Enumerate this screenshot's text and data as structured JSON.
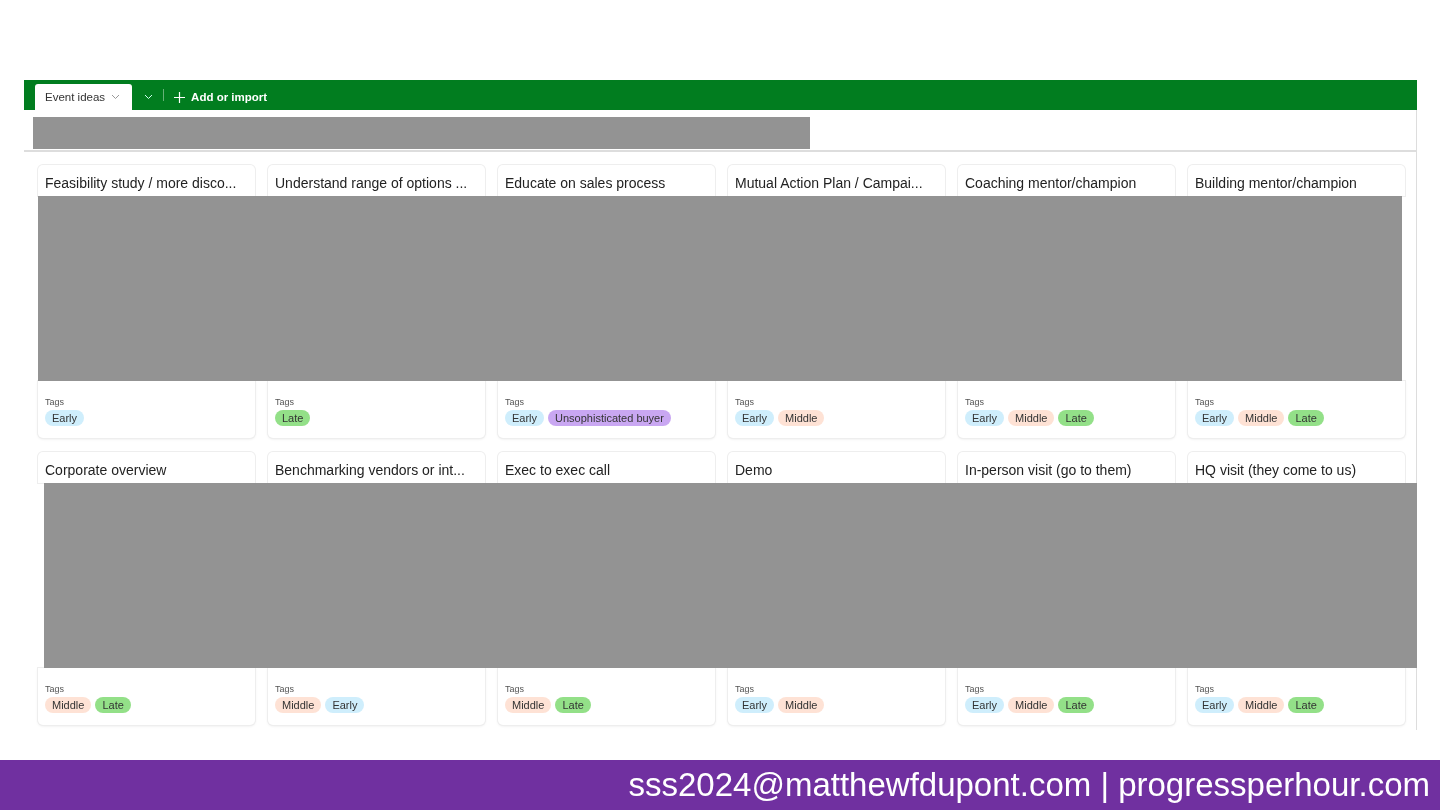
{
  "tab_bar": {
    "tabs": [
      {
        "label": "Event ideas",
        "selected": true
      }
    ],
    "add_button": "Add or import"
  },
  "cards": [
    {
      "title": "Feasibility study / more disco...",
      "tags_label": "Tags",
      "tags": [
        {
          "label": "Early",
          "color": "#cfeefc"
        }
      ]
    },
    {
      "title": "Understand range of options ...",
      "tags_label": "Tags",
      "tags": [
        {
          "label": "Late",
          "color": "#93e088"
        }
      ]
    },
    {
      "title": "Educate on sales process",
      "tags_label": "Tags",
      "tags": [
        {
          "label": "Early",
          "color": "#cfeefc"
        },
        {
          "label": "Unsophisticated buyer",
          "color": "#c9a7f2"
        }
      ]
    },
    {
      "title": "Mutual Action Plan / Campai...",
      "tags_label": "Tags",
      "tags": [
        {
          "label": "Early",
          "color": "#cfeefc"
        },
        {
          "label": "Middle",
          "color": "#fee2d5"
        }
      ]
    },
    {
      "title": "Coaching mentor/champion",
      "tags_label": "Tags",
      "tags": [
        {
          "label": "Early",
          "color": "#cfeefc"
        },
        {
          "label": "Middle",
          "color": "#fee2d5"
        },
        {
          "label": "Late",
          "color": "#93e088"
        }
      ]
    },
    {
      "title": "Building mentor/champion",
      "tags_label": "Tags",
      "tags": [
        {
          "label": "Early",
          "color": "#cfeefc"
        },
        {
          "label": "Middle",
          "color": "#fee2d5"
        },
        {
          "label": "Late",
          "color": "#93e088"
        }
      ]
    },
    {
      "title": "Corporate overview",
      "tags_label": "Tags",
      "tags": [
        {
          "label": "Middle",
          "color": "#fee2d5"
        },
        {
          "label": "Late",
          "color": "#93e088"
        }
      ]
    },
    {
      "title": "Benchmarking vendors or int...",
      "tags_label": "Tags",
      "tags": [
        {
          "label": "Middle",
          "color": "#fee2d5"
        },
        {
          "label": "Early",
          "color": "#cfeefc"
        }
      ]
    },
    {
      "title": "Exec to exec call",
      "tags_label": "Tags",
      "tags": [
        {
          "label": "Middle",
          "color": "#fee2d5"
        },
        {
          "label": "Late",
          "color": "#93e088"
        }
      ]
    },
    {
      "title": "Demo",
      "tags_label": "Tags",
      "tags": [
        {
          "label": "Early",
          "color": "#cfeefc"
        },
        {
          "label": "Middle",
          "color": "#fee2d5"
        }
      ]
    },
    {
      "title": "In-person visit (go to them)",
      "tags_label": "Tags",
      "tags": [
        {
          "label": "Early",
          "color": "#cfeefc"
        },
        {
          "label": "Middle",
          "color": "#fee2d5"
        },
        {
          "label": "Late",
          "color": "#93e088"
        }
      ]
    },
    {
      "title": "HQ visit (they come to us)",
      "tags_label": "Tags",
      "tags": [
        {
          "label": "Early",
          "color": "#cfeefc"
        },
        {
          "label": "Middle",
          "color": "#fee2d5"
        },
        {
          "label": "Late",
          "color": "#93e088"
        }
      ]
    }
  ],
  "footer": {
    "text": "sss2024@matthewfdupont.com | progressperhour.com"
  }
}
